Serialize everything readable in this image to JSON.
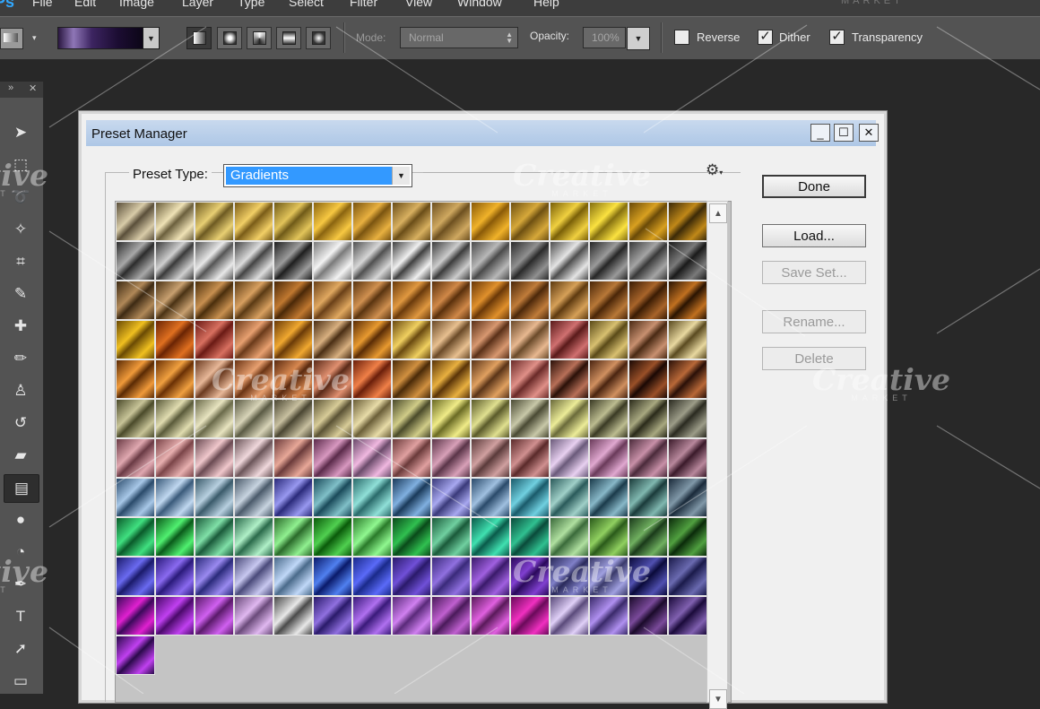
{
  "menu": {
    "items": [
      "File",
      "Edit",
      "Image",
      "Layer",
      "Type",
      "Select",
      "Filter",
      "View",
      "Window",
      "Help"
    ]
  },
  "options_bar": {
    "mode_label": "Mode:",
    "mode_value": "Normal",
    "opacity_label": "Opacity:",
    "opacity_value": "100%",
    "reverse_label": "Reverse",
    "reverse_checked": false,
    "dither_label": "Dither",
    "dither_checked": true,
    "transparency_label": "Transparency",
    "transparency_checked": true,
    "gradient_types": [
      "linear",
      "radial",
      "angle",
      "reflected",
      "diamond"
    ],
    "active_gradient_type": "linear",
    "picker_colors": [
      "#2a1740",
      "#8e76b6",
      "#3c2460",
      "#1c0d33",
      "#0c0617"
    ]
  },
  "tools": [
    {
      "name": "move-tool",
      "glyph": "➤"
    },
    {
      "name": "marquee-tool",
      "glyph": "⬚"
    },
    {
      "name": "lasso-tool",
      "glyph": "➰"
    },
    {
      "name": "magic-wand-tool",
      "glyph": "✧"
    },
    {
      "name": "crop-tool",
      "glyph": "⌗"
    },
    {
      "name": "eyedropper-tool",
      "glyph": "✎"
    },
    {
      "name": "healing-brush-tool",
      "glyph": "✚"
    },
    {
      "name": "brush-tool",
      "glyph": "✏"
    },
    {
      "name": "clone-stamp-tool",
      "glyph": "♙"
    },
    {
      "name": "history-brush-tool",
      "glyph": "↺"
    },
    {
      "name": "eraser-tool",
      "glyph": "▰"
    },
    {
      "name": "gradient-tool",
      "glyph": "▤",
      "active": true
    },
    {
      "name": "blur-tool",
      "glyph": "●"
    },
    {
      "name": "dodge-tool",
      "glyph": "◔"
    },
    {
      "name": "pen-tool",
      "glyph": "✒"
    },
    {
      "name": "type-tool",
      "glyph": "T"
    },
    {
      "name": "path-selection-tool",
      "glyph": "➚"
    },
    {
      "name": "shape-tool",
      "glyph": "▭"
    }
  ],
  "dialog": {
    "title": "Preset Manager",
    "preset_type_label": "Preset Type:",
    "preset_type_value": "Gradients",
    "buttons": [
      {
        "label": "Done",
        "enabled": true,
        "default": true
      },
      {
        "label": "Load...",
        "enabled": true
      },
      {
        "label": "Save Set...",
        "enabled": false
      },
      {
        "label": "Rename...",
        "enabled": false
      },
      {
        "label": "Delete",
        "enabled": false
      }
    ]
  },
  "watermark": {
    "text": "Creative",
    "sub": "MARKET"
  },
  "gradient_rows": [
    {
      "tone": "gold-grey",
      "colors": [
        [
          "#5a4f3a",
          "#d8cba8"
        ],
        [
          "#6b5f3d",
          "#efe2b6"
        ],
        [
          "#6d5a22",
          "#e8cf73"
        ],
        [
          "#7a5c18",
          "#f2cf66"
        ],
        [
          "#6f5a18",
          "#e2c45a"
        ],
        [
          "#8a6410",
          "#f7c842"
        ],
        [
          "#7a5410",
          "#e8b040"
        ],
        [
          "#6a4d18",
          "#d8b060"
        ],
        [
          "#6d5020",
          "#cfa860"
        ],
        [
          "#8a5a08",
          "#f0b22a"
        ],
        [
          "#6e5012",
          "#d6a83a"
        ],
        [
          "#7a6008",
          "#f0d040"
        ],
        [
          "#857010",
          "#fbe240"
        ],
        [
          "#6a4a08",
          "#d8a020"
        ],
        [
          "#3c2a08",
          "#c08818"
        ]
      ]
    },
    {
      "tone": "silver",
      "colors": [
        [
          "#2c2c2c",
          "#a8a8a8"
        ],
        [
          "#3a3a3a",
          "#cfcfcf"
        ],
        [
          "#555",
          "#e8e8e8"
        ],
        [
          "#444",
          "#dcdcdc"
        ],
        [
          "#1e1e1e",
          "#9c9c9c"
        ],
        [
          "#7a7a7a",
          "#f3f3f3"
        ],
        [
          "#505050",
          "#d6d6d6"
        ],
        [
          "#404040",
          "#f0f0f0"
        ],
        [
          "#3c3c3c",
          "#cccccc"
        ],
        [
          "#4a4a4a",
          "#b8b8b8"
        ],
        [
          "#2a2a2a",
          "#909090"
        ],
        [
          "#4e4e4e",
          "#e4e4e4"
        ],
        [
          "#262626",
          "#9a9a9a"
        ],
        [
          "#383838",
          "#a4a4a4"
        ],
        [
          "#1a1a1a",
          "#7a7a7a"
        ]
      ]
    },
    {
      "tone": "bronze",
      "colors": [
        [
          "#3d2a14",
          "#b08858"
        ],
        [
          "#4a3214",
          "#c8a070"
        ],
        [
          "#4a2e0c",
          "#c89050"
        ],
        [
          "#5a3a14",
          "#d8a060"
        ],
        [
          "#4a2808",
          "#c07830"
        ],
        [
          "#6a4018",
          "#e0a860"
        ],
        [
          "#5a3410",
          "#d09050"
        ],
        [
          "#6a3a0c",
          "#e09840"
        ],
        [
          "#5a300c",
          "#d08848"
        ],
        [
          "#6a3808",
          "#e0902c"
        ],
        [
          "#4c280a",
          "#c07c3a"
        ],
        [
          "#5e3a10",
          "#d6a058"
        ],
        [
          "#4a2608",
          "#b87838"
        ],
        [
          "#3a1c04",
          "#a8642a"
        ],
        [
          "#2a1402",
          "#c07020"
        ]
      ]
    },
    {
      "tone": "gold-copper",
      "colors": [
        [
          "#6a4a04",
          "#f0c020"
        ],
        [
          "#6a2404",
          "#e07020"
        ],
        [
          "#6a1a14",
          "#d87060"
        ],
        [
          "#6a3a1a",
          "#e8a070"
        ],
        [
          "#6a3a08",
          "#f0a830"
        ],
        [
          "#4a2e14",
          "#d8b080"
        ],
        [
          "#5a2c06",
          "#e89a30"
        ],
        [
          "#6a4a10",
          "#f0d060"
        ],
        [
          "#6a4a28",
          "#e8c090"
        ],
        [
          "#5a3018",
          "#d89870"
        ],
        [
          "#6a4a2a",
          "#e8b890"
        ],
        [
          "#5a1a1a",
          "#d07070"
        ],
        [
          "#5a4a18",
          "#d8c070"
        ],
        [
          "#4a2a14",
          "#c89070"
        ],
        [
          "#5a4a20",
          "#e8d8a0"
        ]
      ]
    },
    {
      "tone": "orange",
      "colors": [
        [
          "#5a2a04",
          "#f09a3a"
        ],
        [
          "#6a3004",
          "#f0a040"
        ],
        [
          "#6a3a20",
          "#e8b898"
        ],
        [
          "#6a3414",
          "#e8a070"
        ],
        [
          "#5a2a10",
          "#d88850"
        ],
        [
          "#5a2a18",
          "#e09070"
        ],
        [
          "#6a1e0a",
          "#f08048"
        ],
        [
          "#4a2a08",
          "#d09040"
        ],
        [
          "#5a3408",
          "#e8b040"
        ],
        [
          "#5a3418",
          "#e0a060"
        ],
        [
          "#6a2a28",
          "#e09088"
        ],
        [
          "#2a1008",
          "#b87058"
        ],
        [
          "#4a2410",
          "#d09060"
        ],
        [
          "#1a0804",
          "#9a5028"
        ],
        [
          "#2a1008",
          "#b86838"
        ]
      ]
    },
    {
      "tone": "khaki",
      "colors": [
        [
          "#4a4a2a",
          "#c8c498"
        ],
        [
          "#5a5a3a",
          "#e0dcb0"
        ],
        [
          "#6a6a4a",
          "#e8e4c0"
        ],
        [
          "#5a5a44",
          "#d8d4b8"
        ],
        [
          "#4a4632",
          "#c8c0a0"
        ],
        [
          "#5a5234",
          "#d8cc98"
        ],
        [
          "#6a5e38",
          "#e8dca8"
        ],
        [
          "#4a4a2a",
          "#d0cc88"
        ],
        [
          "#6a6a24",
          "#f0ec88"
        ],
        [
          "#5a5a2a",
          "#e0e090"
        ],
        [
          "#4a4a34",
          "#c8c8a8"
        ],
        [
          "#6a6a3a",
          "#ecec98"
        ],
        [
          "#3a3a24",
          "#bcbc90"
        ],
        [
          "#2a2a1a",
          "#a8a880"
        ],
        [
          "#2a2a20",
          "#9c9c88"
        ]
      ]
    },
    {
      "tone": "pink-mauve",
      "colors": [
        [
          "#6a3a44",
          "#e0a8b0"
        ],
        [
          "#7a4448",
          "#e8b0b0"
        ],
        [
          "#6a4a52",
          "#f0c8cc"
        ],
        [
          "#6a5458",
          "#f0d8dc"
        ],
        [
          "#6a3a3a",
          "#e8a898"
        ],
        [
          "#5a2a4a",
          "#d898c0"
        ],
        [
          "#6a4a6a",
          "#f0b8e0"
        ],
        [
          "#6a3a3a",
          "#e0a0a0"
        ],
        [
          "#5a3448",
          "#d8a0b8"
        ],
        [
          "#5a3a3a",
          "#d0a0a0"
        ],
        [
          "#5a2a2a",
          "#d09090"
        ],
        [
          "#6a5a7a",
          "#e8d0f0"
        ],
        [
          "#6a3a5a",
          "#e0a8d0"
        ],
        [
          "#4a2a3a",
          "#c890a8"
        ],
        [
          "#3a1a2a",
          "#b8889c"
        ]
      ]
    },
    {
      "tone": "blue-teal",
      "colors": [
        [
          "#2a4a6a",
          "#a8c8e8"
        ],
        [
          "#3a5a7a",
          "#c0d8f0"
        ],
        [
          "#3a5a6a",
          "#b8d0e0"
        ],
        [
          "#4a5a6a",
          "#c8d4e0"
        ],
        [
          "#2a2a7a",
          "#9898f0"
        ],
        [
          "#1a4a5a",
          "#80c0c8"
        ],
        [
          "#2a6a6a",
          "#90e0d8"
        ],
        [
          "#1a3a5a",
          "#80b0e0"
        ],
        [
          "#3a3a7a",
          "#a8a8f0"
        ],
        [
          "#2a4a6a",
          "#a0c0e0"
        ],
        [
          "#1a5a6a",
          "#70d0e0"
        ],
        [
          "#2a5a5a",
          "#a0d0c8"
        ],
        [
          "#1a3a4a",
          "#88b8c8"
        ],
        [
          "#1a3a3a",
          "#80b8b0"
        ],
        [
          "#1a2a3a",
          "#8098a8"
        ]
      ]
    },
    {
      "tone": "green",
      "colors": [
        [
          "#0a5a2a",
          "#40e080"
        ],
        [
          "#0a5a1a",
          "#50f070"
        ],
        [
          "#1a5a3a",
          "#80e0a8"
        ],
        [
          "#2a6a4a",
          "#b0f0c8"
        ],
        [
          "#2a6a2a",
          "#90f090"
        ],
        [
          "#0a5a0a",
          "#50d050"
        ],
        [
          "#2a7a2a",
          "#90f890"
        ],
        [
          "#0a4a1a",
          "#30c050"
        ],
        [
          "#1a5a3a",
          "#70d0a0"
        ],
        [
          "#0a5a4a",
          "#40e0b0"
        ],
        [
          "#0a4a3a",
          "#30c090"
        ],
        [
          "#3a6a3a",
          "#b0e0a0"
        ],
        [
          "#2a5a1a",
          "#90d060"
        ],
        [
          "#1a3a1a",
          "#70b060"
        ],
        [
          "#0a2a0a",
          "#50a040"
        ]
      ]
    },
    {
      "tone": "indigo",
      "colors": [
        [
          "#1a1a6a",
          "#6a6af0"
        ],
        [
          "#2a1a7a",
          "#8a6af0"
        ],
        [
          "#2a2a7a",
          "#9a8af0"
        ],
        [
          "#4a4a7a",
          "#c8c8f0"
        ],
        [
          "#4a6a8a",
          "#c0d8f8"
        ],
        [
          "#0a1a6a",
          "#5080f0"
        ],
        [
          "#1a2a8a",
          "#5a6af8"
        ],
        [
          "#2a1a6a",
          "#7050d8"
        ],
        [
          "#3a2a7a",
          "#9070e0"
        ],
        [
          "#3a1a6a",
          "#a060e0"
        ],
        [
          "#2a0a5a",
          "#8040d0"
        ],
        [
          "#2a2a5a",
          "#8080c8"
        ],
        [
          "#3a3a6a",
          "#a0a0e0"
        ],
        [
          "#0a0a3a",
          "#5050b0"
        ],
        [
          "#1a1a4a",
          "#6a6ab0"
        ]
      ]
    },
    {
      "tone": "purple-magenta",
      "colors": [
        [
          "#3a0a5a",
          "#e020d0"
        ],
        [
          "#4a0a6a",
          "#c040f0"
        ],
        [
          "#5a1a6a",
          "#d060f0"
        ],
        [
          "#6a4a7a",
          "#e0b8f0"
        ],
        [
          "#4a4a4a",
          "#e8e8e8"
        ],
        [
          "#2a1a6a",
          "#9070e0"
        ],
        [
          "#3a1a7a",
          "#b070f0"
        ],
        [
          "#5a2a7a",
          "#d080f0"
        ],
        [
          "#4a1a5a",
          "#c060d0"
        ],
        [
          "#5a1a5a",
          "#e060e0"
        ],
        [
          "#6a0a5a",
          "#f030c0"
        ],
        [
          "#5a4a7a",
          "#e0d0f8"
        ],
        [
          "#3a2a6a",
          "#b090f0"
        ],
        [
          "#1a0a2a",
          "#7a4a9a"
        ],
        [
          "#1a0a3a",
          "#8060b0"
        ]
      ]
    },
    {
      "tone": "cut-off",
      "colors": [
        [
          "#2a0a4a",
          "#c040f0"
        ]
      ]
    }
  ]
}
